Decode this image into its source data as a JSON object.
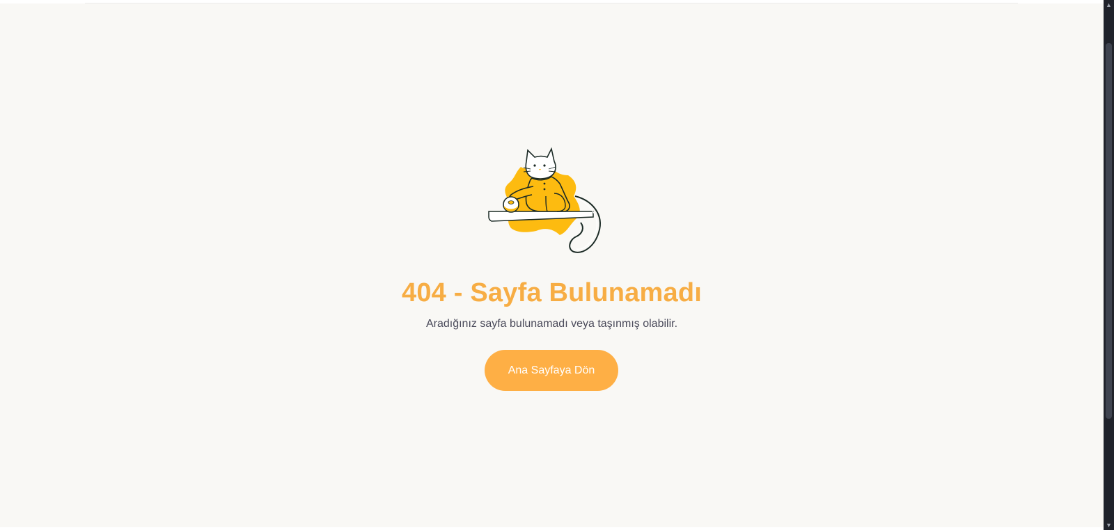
{
  "error": {
    "title": "404 - Sayfa Bulunamadı",
    "message": "Aradığınız sayfa bulunamadı veya taşınmış olabilir.",
    "button_label": "Ana Sayfaya Dön"
  },
  "illustration": {
    "icon": "cat-on-shelf-illustration",
    "accent_color": "#fdbb10"
  },
  "colors": {
    "title": "#f7ad44",
    "button": "#feaf45",
    "background": "#f9f8f5",
    "text": "#4a4a5a"
  },
  "scrollbar": {
    "up_icon": "chevron-up-icon",
    "down_icon": "chevron-down-icon"
  }
}
